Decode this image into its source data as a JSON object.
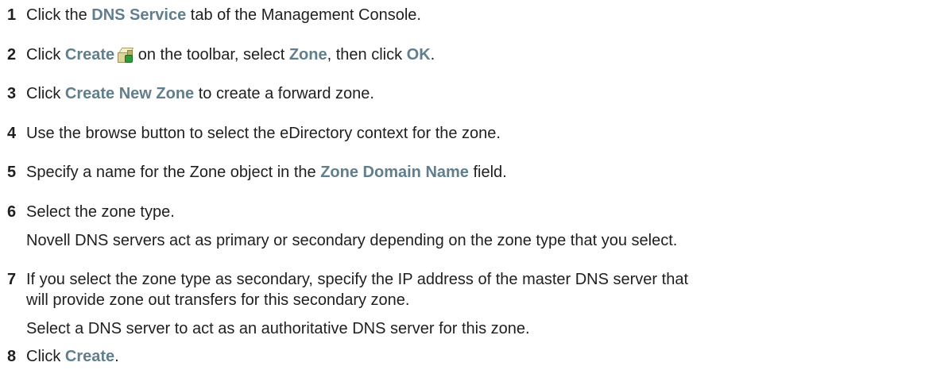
{
  "steps": [
    {
      "num": "1",
      "parts": [
        "Click the ",
        "DNS Service",
        " tab of the Management Console."
      ]
    },
    {
      "num": "2",
      "parts": [
        "Click ",
        "Create",
        " on the toolbar, select ",
        "Zone",
        ", then click ",
        "OK",
        "."
      ]
    },
    {
      "num": "3",
      "parts": [
        "Click ",
        "Create New Zone",
        " to create a forward zone."
      ]
    },
    {
      "num": "4",
      "text": "Use the browse button to select the eDirectory context for the zone."
    },
    {
      "num": "5",
      "parts": [
        "Specify a name for the Zone object in the ",
        "Zone Domain Name",
        " field."
      ]
    },
    {
      "num": "6",
      "text": "Select the zone type.",
      "note": "Novell DNS servers act as primary or secondary depending on the zone type that you select."
    },
    {
      "num": "7",
      "line1": "If you select the zone type as secondary, specify the IP address of the master DNS server that",
      "line2": "will provide zone out transfers for this secondary zone.",
      "note": "Select a DNS server to act as an authoritative DNS server for this zone."
    },
    {
      "num": "8",
      "parts": [
        "Click ",
        "Create",
        "."
      ]
    }
  ],
  "icons": {
    "create_icon": "create-object-icon"
  },
  "colors": {
    "ui_text": "#617e8c",
    "body_text": "#1f1f1f"
  }
}
